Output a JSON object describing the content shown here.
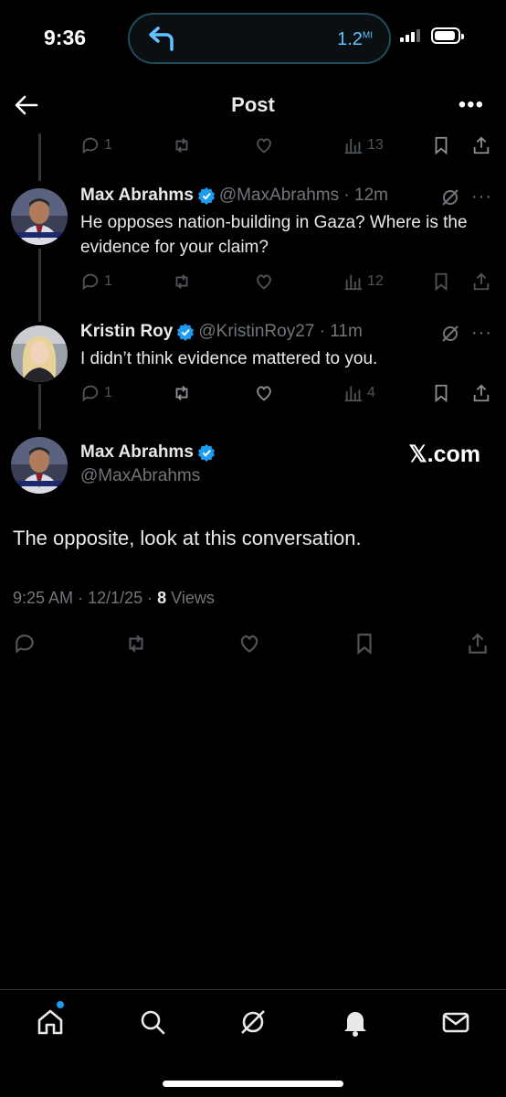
{
  "status": {
    "time": "9:36",
    "island_distance": "1.2",
    "island_unit": "MI"
  },
  "header": {
    "title": "Post"
  },
  "top_partial_actions": {
    "replies": "1",
    "views": "13"
  },
  "replies": [
    {
      "name": "Max Abrahms",
      "handle": "@MaxAbrahms",
      "time": "12m",
      "text": "He opposes nation-building in Gaza? Where is the evidence for your claim?",
      "replies": "1",
      "views": "12"
    },
    {
      "name": "Kristin Roy",
      "handle": "@KristinRoy27",
      "time": "11m",
      "text": "I didn’t think evidence mattered to you.",
      "replies": "1",
      "views": "4"
    }
  ],
  "main_post": {
    "name": "Max Abrahms",
    "handle": "@MaxAbrahms",
    "watermark": "𝕏.com",
    "text": "The opposite, look at this conversation.",
    "time": "9:25 AM",
    "date": "12/1/25",
    "views_count": "8",
    "views_label": "Views"
  },
  "tabbar": {
    "items": [
      "home-icon",
      "search-icon",
      "grok-icon",
      "notifications-icon",
      "messages-icon"
    ]
  },
  "colors": {
    "accent": "#1d9bf0",
    "background": "#000000",
    "muted": "#71767b"
  }
}
